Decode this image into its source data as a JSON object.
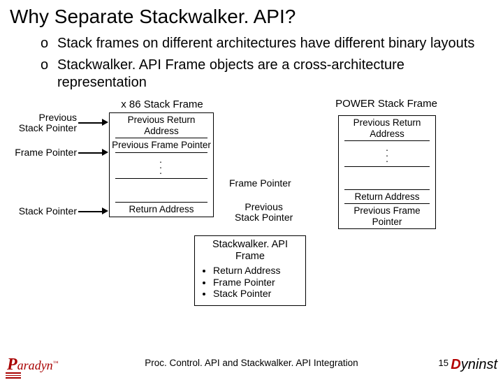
{
  "title": "Why Separate Stackwalker. API?",
  "bullets": [
    "Stack frames on different architectures have different binary layouts",
    "Stackwalker. API Frame objects are a cross-architecture representation"
  ],
  "labels": {
    "prev_sp": "Previous\nStack Pointer",
    "fp": "Frame Pointer",
    "sp": "Stack Pointer",
    "fp_mid": "Frame Pointer",
    "prev_sp_mid": "Previous\nStack Pointer"
  },
  "x86": {
    "head": "x 86 Stack Frame",
    "c1": "Previous Return Address",
    "c2": "Previous Frame Pointer",
    "dots": ". . .",
    "c3": "Return Address"
  },
  "power": {
    "head": "POWER Stack Frame",
    "c1": "Previous Return Address",
    "dots": ". . .",
    "c2": "Return Address",
    "c3": "Previous Frame Pointer"
  },
  "swapi": {
    "h": "Stackwalker. API Frame",
    "i1": "Return Address",
    "i2": "Frame Pointer",
    "i3": "Stack Pointer"
  },
  "footer": {
    "text": "Proc. Control. API and Stackwalker. API Integration",
    "page": "15"
  },
  "logos": {
    "dyn_d": "D",
    "dyn_rest": "yninst",
    "para": "ara",
    "para_p": "P",
    "dyn_word": "dyn",
    "tm": "™"
  }
}
